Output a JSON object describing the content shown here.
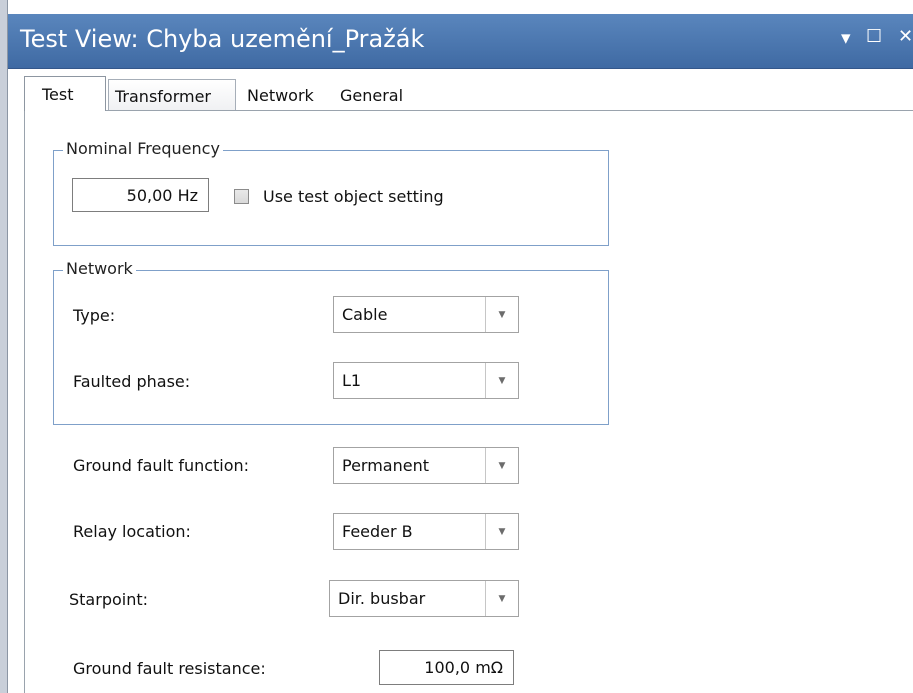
{
  "window": {
    "title": "Test View: Chyba uzemění_Pražák",
    "dropdown_glyph": "▾",
    "restore_glyph": "☐",
    "close_glyph": "✕"
  },
  "tabs": [
    {
      "label": "Test",
      "active": true
    },
    {
      "label": "Transformer",
      "active": false
    },
    {
      "label": "Network",
      "active": false
    },
    {
      "label": "General",
      "active": false
    }
  ],
  "nominal_frequency": {
    "legend": "Nominal Frequency",
    "value": "50,00  Hz",
    "use_test_object_label": "Use test object setting",
    "use_test_object_checked": false
  },
  "network": {
    "legend": "Network",
    "type_label": "Type:",
    "type_value": "Cable",
    "faulted_phase_label": "Faulted phase:",
    "faulted_phase_value": "L1"
  },
  "fields": {
    "ground_fault_function_label": "Ground fault function:",
    "ground_fault_function_value": "Permanent",
    "relay_location_label": "Relay location:",
    "relay_location_value": "Feeder B",
    "starpoint_label": "Starpoint:",
    "starpoint_value": "Dir. busbar",
    "ground_fault_resistance_label": "Ground fault resistance:",
    "ground_fault_resistance_value": "100,0 mΩ"
  },
  "icons": {
    "combo_arrow": "▼"
  },
  "colors": {
    "titlebar": "#4a77b0",
    "group_border": "#7fa0c9"
  }
}
